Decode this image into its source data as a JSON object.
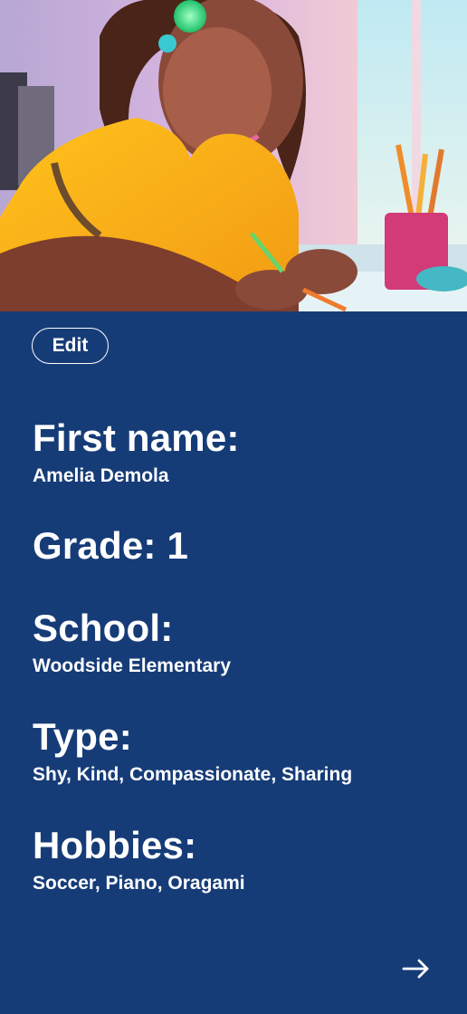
{
  "profile": {
    "edit_label": "Edit",
    "first_name_label": "First name:",
    "first_name_value": "Amelia Demola",
    "grade_label": "Grade: 1",
    "school_label": "School:",
    "school_value": "Woodside Elementary",
    "type_label": "Type:",
    "type_value": "Shy, Kind, Compassionate, Sharing",
    "hobbies_label": "Hobbies:",
    "hobbies_value": "Soccer, Piano, Oragami"
  },
  "icons": {
    "next": "arrow-right-icon"
  },
  "colors": {
    "background": "#163c78",
    "text": "#ffffff"
  }
}
